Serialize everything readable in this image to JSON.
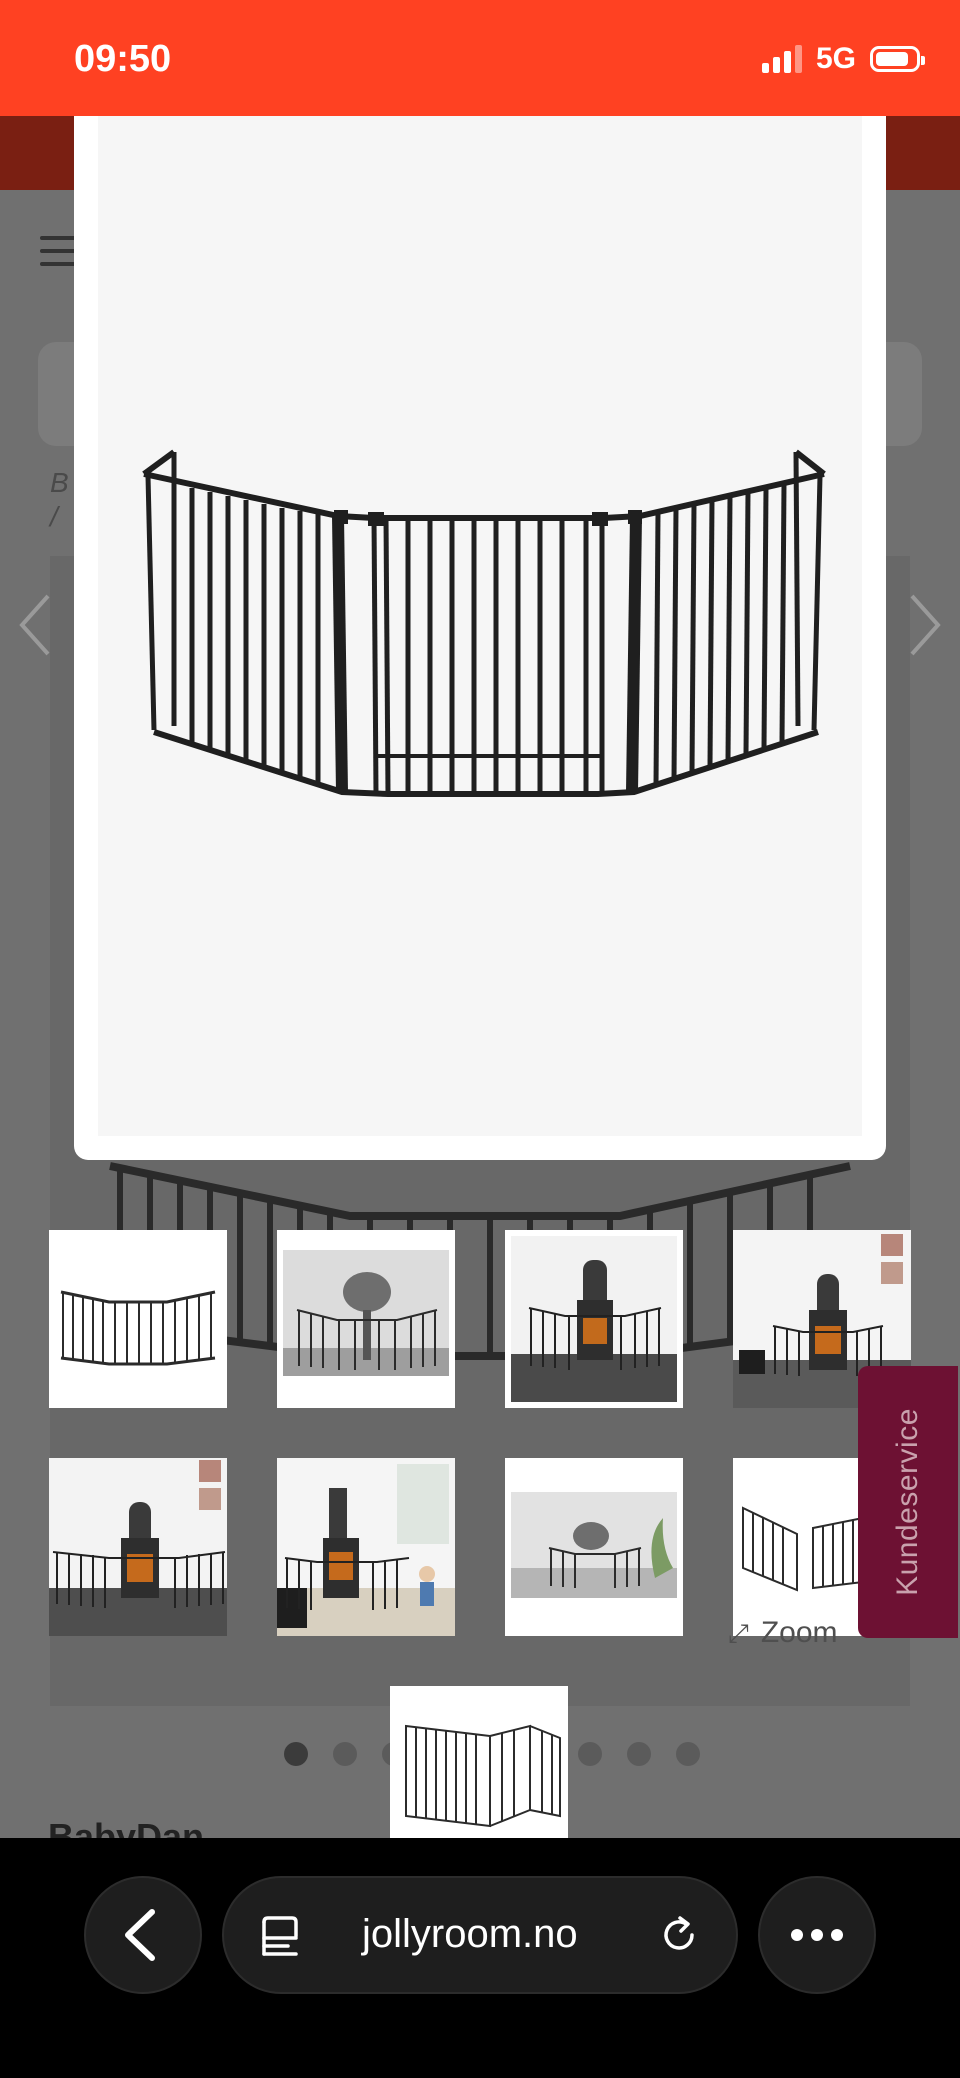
{
  "status_bar": {
    "time": "09:50",
    "network": "5G",
    "icons": [
      "signal-icon",
      "battery-icon"
    ]
  },
  "background_page": {
    "breadcrumb_fragment": [
      "B",
      "/"
    ],
    "zoom_label": "Zoom",
    "brand_fragment": "BabyDan",
    "kundeservice_label": "Kundeservice",
    "carousel": {
      "total_dots": 9,
      "active_index": 0
    }
  },
  "modal": {
    "image_subject": "fireplace-safety-gate-image"
  },
  "thumbnails": [
    "gate-white-background",
    "gate-around-grill",
    "gate-around-stove",
    "stove-with-gate-room",
    "stove-with-gate-wide",
    "child-next-to-stove-gate",
    "grill-with-gate-outdoor",
    "gate-corner-panels"
  ],
  "browser": {
    "url": "jollyroom.no",
    "icons": [
      "back-icon",
      "tabs-icon",
      "reload-icon",
      "more-icon"
    ]
  }
}
